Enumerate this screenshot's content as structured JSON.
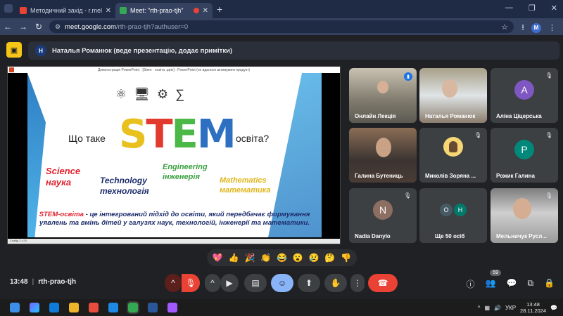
{
  "browser": {
    "tabs": [
      {
        "title": "Методичний захід - r.melnychu",
        "active": false
      },
      {
        "title": "Meet: \"rth-prao-tjh\"",
        "active": true
      }
    ],
    "url_host": "meet.google.com",
    "url_rest": "/rth-prao-tjh?authuser=0",
    "profile_initial": "M"
  },
  "presenter": {
    "initial": "Н",
    "label": "Наталья Романюк (веде презентацію, додає примітки)"
  },
  "slide": {
    "titlebar": "Демонстрація PowerPoint - [Stem - освіта .pptx] - PowerPoint (не вдалося активувати продукт)",
    "question_left": "Що таке",
    "stem_letters": [
      "S",
      "T",
      "E",
      "M"
    ],
    "question_right": "освіта?",
    "science": [
      "Science",
      "наука"
    ],
    "technology": [
      "Technology",
      "технологія"
    ],
    "engineering": [
      "Engineering",
      "інженерія"
    ],
    "mathematics": [
      "Mathematics",
      "математика"
    ],
    "definition_highlight": "STEM-освіта",
    "definition_rest": " - це інтегрований підхід до освіти, який передбачає формування уявлень та вмінь дітей у галузях наук, технологій, інженерії та математики.",
    "statusbar": "Слайд 2 з 20"
  },
  "participants": [
    {
      "name": "Онлайн Лекція",
      "type": "video",
      "speaking": true
    },
    {
      "name": "Наталья Романюк",
      "type": "video",
      "speaking": false
    },
    {
      "name": "Аліна Ціцерська",
      "type": "letter",
      "letter": "A",
      "color": "#7e57c2"
    },
    {
      "name": "Галина Бутениць",
      "type": "video",
      "speaking": false
    },
    {
      "name": "Миколів Зоряна ...",
      "type": "avatar"
    },
    {
      "name": "Рожик Галина",
      "type": "letter",
      "letter": "P",
      "color": "#00897b"
    },
    {
      "name": "Nadia Danylo",
      "type": "letter",
      "letter": "N",
      "color": "#8d6e63"
    },
    {
      "name": "Ще 50 осіб",
      "type": "more",
      "letters": [
        "O",
        "H"
      ]
    },
    {
      "name": "Мельничук Русл...",
      "type": "video"
    }
  ],
  "reactions": [
    "💖",
    "👍",
    "🎉",
    "👏",
    "😂",
    "😮",
    "😢",
    "🤔",
    "👎"
  ],
  "controls": {
    "time": "13:48",
    "meeting_code": "rth-prao-tjh",
    "participant_count": "59"
  },
  "taskbar": {
    "lang": "УКР",
    "time": "13:48",
    "date": "28.11.2024"
  }
}
